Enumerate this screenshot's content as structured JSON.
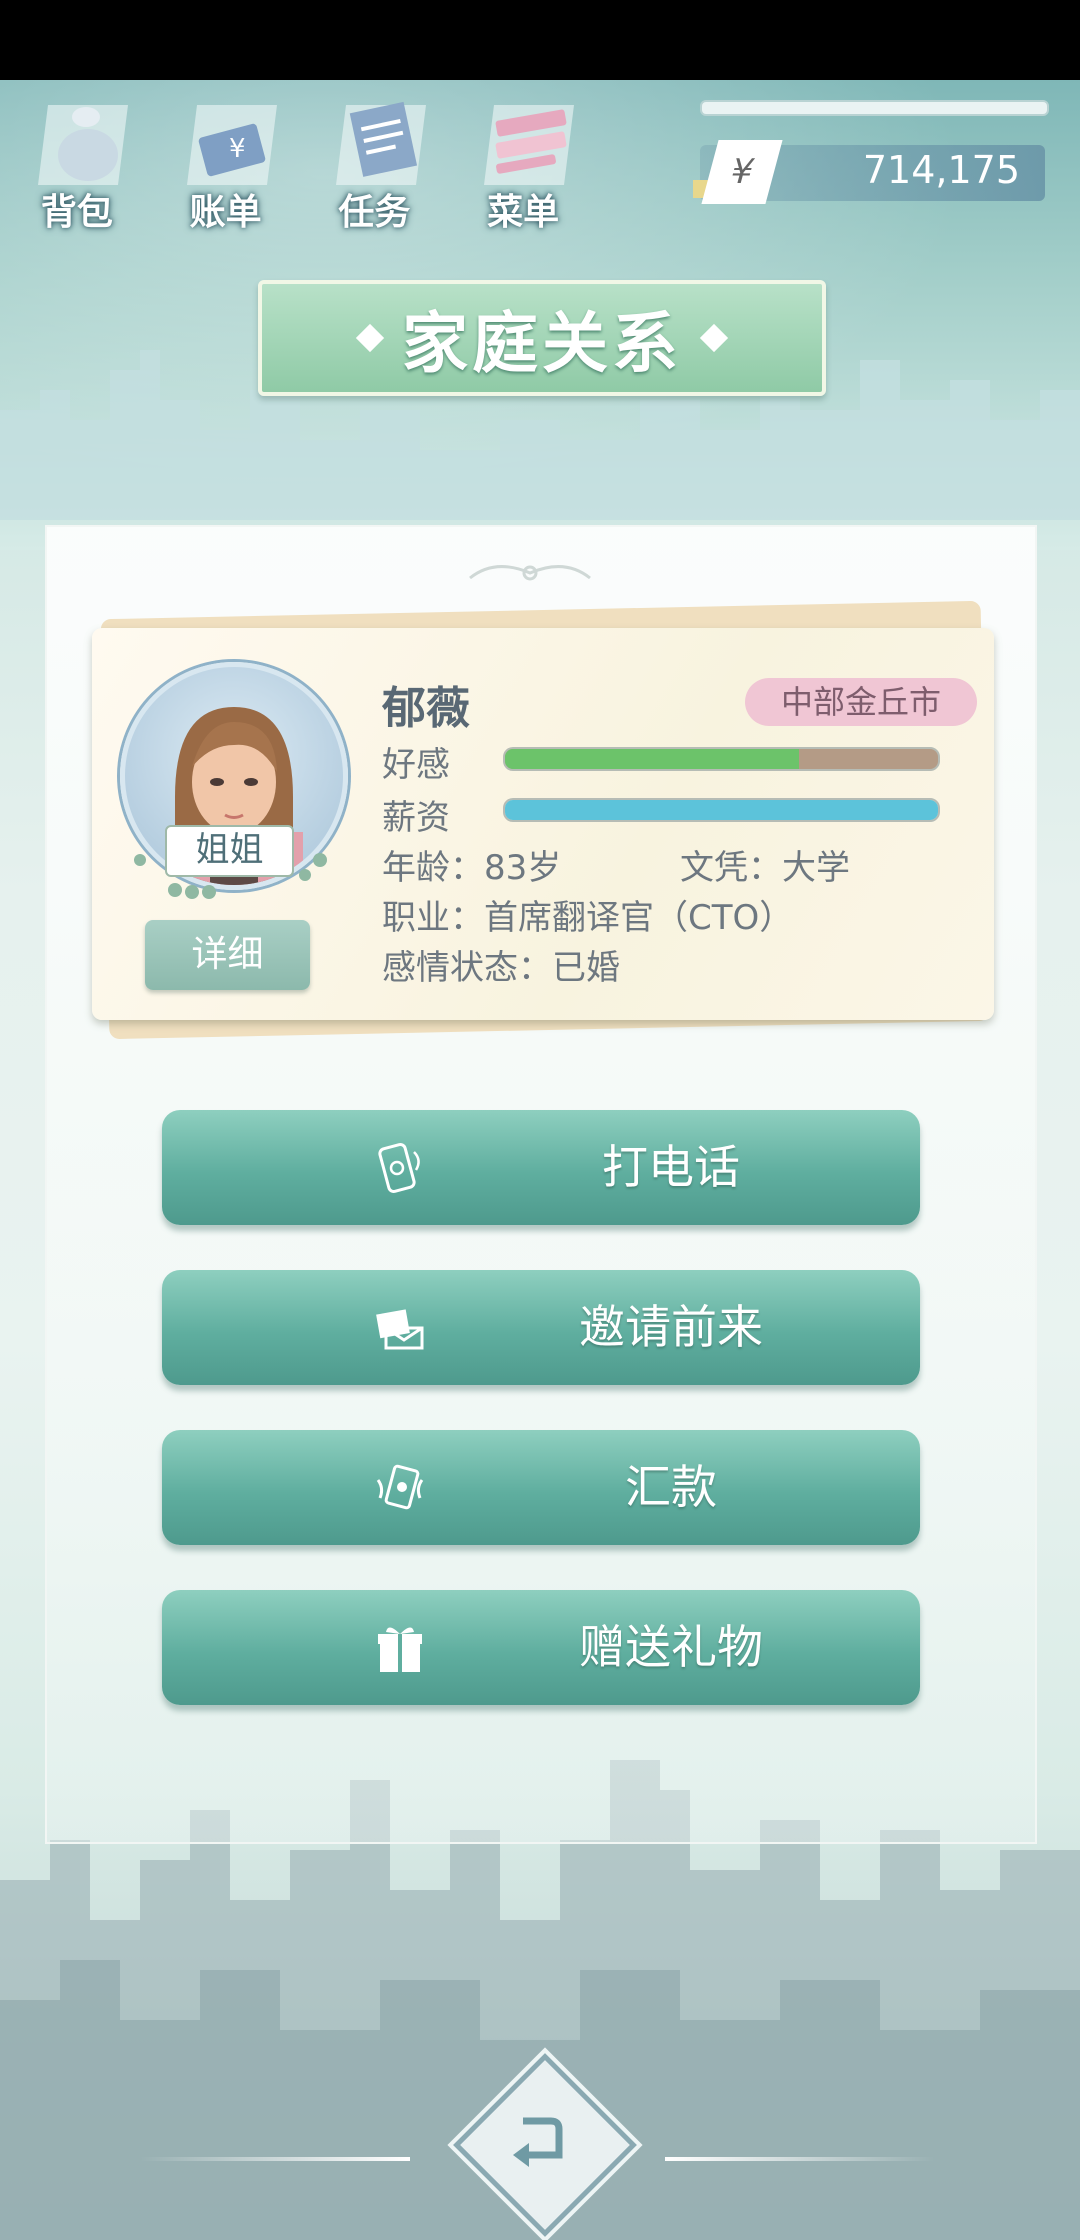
{
  "toolbar": {
    "items": [
      {
        "label": "背包",
        "icon": "bag-icon"
      },
      {
        "label": "账单",
        "icon": "bill-icon"
      },
      {
        "label": "任务",
        "icon": "task-icon"
      },
      {
        "label": "菜单",
        "icon": "menu-icon"
      }
    ]
  },
  "money": {
    "currency_symbol": "¥",
    "amount": "714,175"
  },
  "page_title": "家庭关系",
  "profile": {
    "name": "郁薇",
    "city": "中部金丘市",
    "relation": "姐姐",
    "detail_button": "详细",
    "affection_label": "好感",
    "affection_level": 0.68,
    "salary_label": "薪资",
    "salary_level": 1.0,
    "age_text": "年龄：83岁",
    "education_text": "文凭：大学",
    "job_text": "职业：首席翻译官（CTO）",
    "relationship_text": "感情状态：已婚"
  },
  "actions": [
    {
      "label": "打电话",
      "icon": "phone-icon"
    },
    {
      "label": "邀请前来",
      "icon": "invite-icon"
    },
    {
      "label": "汇款",
      "icon": "money-transfer-icon"
    },
    {
      "label": "赠送礼物",
      "icon": "gift-icon"
    }
  ],
  "colors": {
    "affection_fill": "#6cc36a",
    "affection_rest": "#b49b86",
    "salary_fill": "#5cc3da",
    "button_teal": "#5fae9f",
    "city_badge": "#f0c6d4"
  }
}
